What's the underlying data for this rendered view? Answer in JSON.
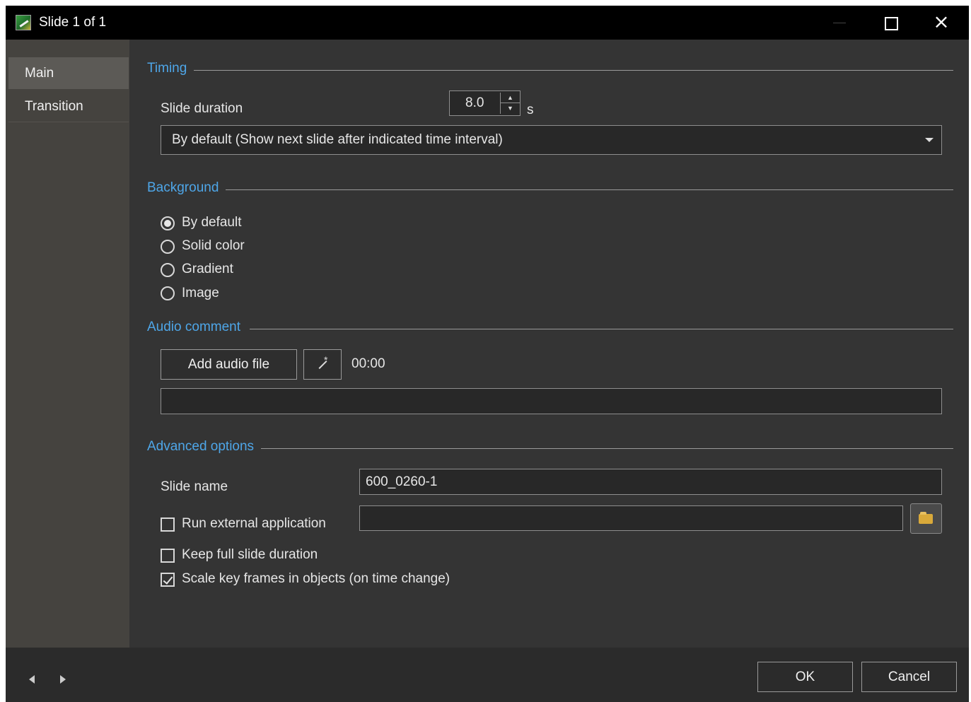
{
  "window": {
    "title": "Slide 1 of 1"
  },
  "sidebar": {
    "items": [
      {
        "label": "Main"
      },
      {
        "label": "Transition"
      }
    ]
  },
  "timing": {
    "section_title": "Timing",
    "duration_label": "Slide duration",
    "duration_value": "8.0",
    "duration_unit": "s",
    "mode_selected": "By default (Show next slide after indicated time interval)"
  },
  "background": {
    "section_title": "Background",
    "options": [
      {
        "label": "By default"
      },
      {
        "label": "Solid color"
      },
      {
        "label": "Gradient"
      },
      {
        "label": "Image"
      }
    ],
    "selected": "By default"
  },
  "audio": {
    "section_title": "Audio comment",
    "add_button": "Add audio file",
    "time": "00:00",
    "file_path": ""
  },
  "advanced": {
    "section_title": "Advanced options",
    "slide_name_label": "Slide name",
    "slide_name_value": "600_0260-1",
    "run_external_label": "Run external application",
    "run_external_checked": false,
    "external_app_path": "",
    "keep_full_label": "Keep full slide duration",
    "keep_full_checked": false,
    "scale_keyframes_label": "Scale key frames in objects (on time change)",
    "scale_keyframes_checked": true
  },
  "footer": {
    "ok_label": "OK",
    "cancel_label": "Cancel"
  },
  "icons": {
    "app": "app-slide-icon",
    "minimize": "minimize-icon",
    "maximize": "maximize-icon",
    "close": "close-icon",
    "spin_up": "spin-up-icon",
    "spin_down": "spin-down-icon",
    "dropdown": "chevron-down-icon",
    "wand": "magic-wand-icon",
    "folder": "folder-open-icon",
    "prev": "prev-arrow-icon",
    "next": "next-arrow-icon"
  },
  "colors": {
    "accent": "#4ea6e8",
    "background": "#343434",
    "sidebar": "#45433f",
    "titlebar": "#000000"
  }
}
